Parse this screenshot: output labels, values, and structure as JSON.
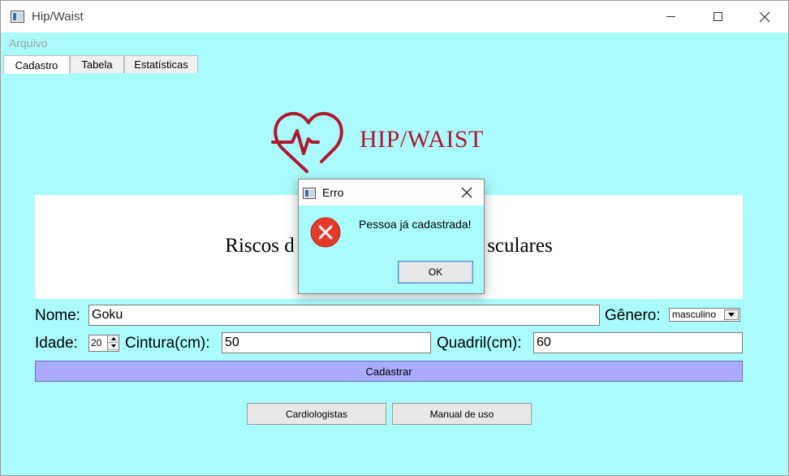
{
  "window": {
    "title": "Hip/Waist"
  },
  "menu": {
    "arquivo": "Arquivo"
  },
  "tabs": [
    {
      "label": "Cadastro"
    },
    {
      "label": "Tabela"
    },
    {
      "label": "Estatísticas"
    }
  ],
  "logo": {
    "text": "HIP/WAIST",
    "icon": "heart-pulse-icon",
    "color": "#b0182f"
  },
  "banner": {
    "title": "Riscos d                                      sculares"
  },
  "form": {
    "nome_label": "Nome:",
    "nome_value": "Goku",
    "genero_label": "Gênero:",
    "genero_value": "masculino",
    "idade_label": "Idade:",
    "idade_value": "20",
    "cintura_label": "Cintura(cm):",
    "cintura_value": "50",
    "quadril_label": "Quadril(cm):",
    "quadril_value": "60"
  },
  "buttons": {
    "cadastrar": "Cadastrar",
    "cardiologistas": "Cardiologistas",
    "manual": "Manual de uso"
  },
  "dialog": {
    "title": "Erro",
    "message": "Pessoa já cadastrada!",
    "ok": "OK",
    "icon": "error-icon"
  },
  "colors": {
    "background": "#aafcfc",
    "cadastrar_button": "#aaaaff",
    "error_red": "#e53a2a"
  }
}
